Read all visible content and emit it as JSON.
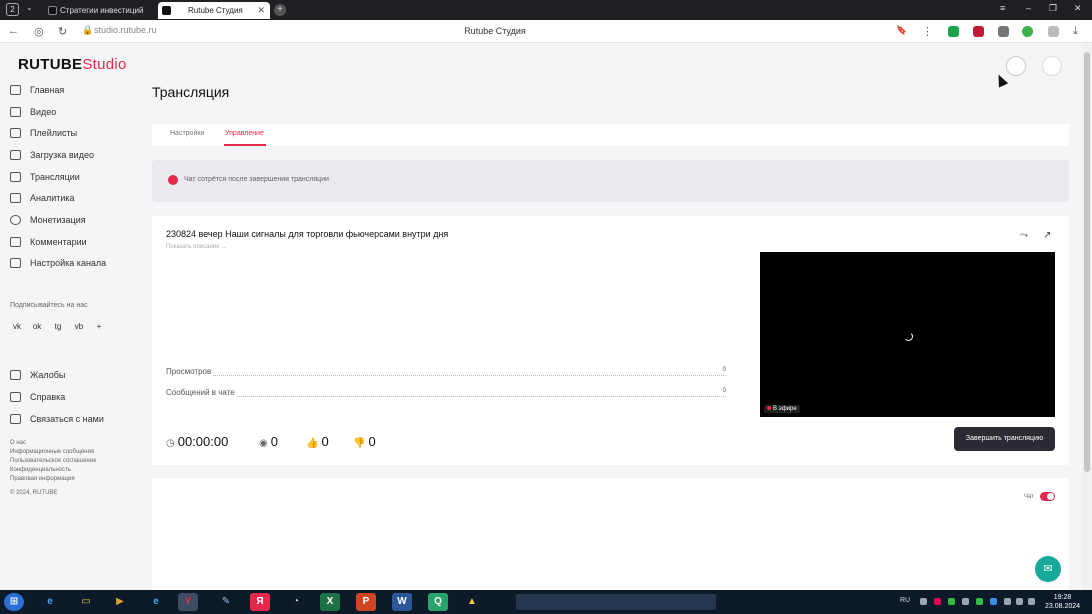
{
  "browser": {
    "tab_count": "2",
    "tabs": [
      {
        "label": "Стратегии инвестиций"
      },
      {
        "label": "Rutube Студия"
      }
    ],
    "url": "studio.rutube.ru",
    "page_title": "Rutube Студия",
    "window_controls": {
      "menu": "≡",
      "minimize": "–",
      "maximize": "❐",
      "close": "✕"
    }
  },
  "logo": {
    "brand": "RUTUBE",
    "product": "Studio"
  },
  "sidebar": {
    "items": [
      {
        "label": "Главная",
        "icon": "home-icon"
      },
      {
        "label": "Видео",
        "icon": "video-icon"
      },
      {
        "label": "Плейлисты",
        "icon": "playlist-icon"
      },
      {
        "label": "Загрузка видео",
        "icon": "upload-icon"
      },
      {
        "label": "Трансляции",
        "icon": "broadcast-icon"
      },
      {
        "label": "Аналитика",
        "icon": "analytics-icon"
      },
      {
        "label": "Монетизация",
        "icon": "money-icon"
      },
      {
        "label": "Комментарии",
        "icon": "comments-icon"
      },
      {
        "label": "Настройка канала",
        "icon": "settings-icon"
      }
    ],
    "subscribe_label": "Подписывайтесь на нас",
    "social": [
      "vk",
      "ok",
      "tg",
      "vb",
      "+"
    ],
    "support": [
      {
        "label": "Жалобы",
        "icon": "flag-icon"
      },
      {
        "label": "Справка",
        "icon": "help-icon"
      },
      {
        "label": "Связаться с нами",
        "icon": "phone-icon"
      }
    ],
    "footer_links": [
      "О нас",
      "Информационные сообщения",
      "Пользовательское соглашение",
      "Конфиденциальность",
      "Правовая информация"
    ],
    "copyright": "© 2024, RUTUBE"
  },
  "main": {
    "title": "Трансляция",
    "tabs": [
      {
        "label": "Настройки"
      },
      {
        "label": "Управление"
      }
    ],
    "notice": "Чат сотрётся после завершения трансляции",
    "stream": {
      "title": "230824 вечер Наши сигналы для торговли фьючерсами внутри дня",
      "show_description": "Показать описание",
      "stats": [
        {
          "label": "Просмотров",
          "value": "0"
        },
        {
          "label": "Сообщений в чате",
          "value": "0"
        }
      ],
      "live_badge": "В эфире",
      "duration": "00:00:00",
      "viewers": "0",
      "likes": "0",
      "dislikes": "0",
      "end_button": "Завершить трансляцию"
    },
    "chat": {
      "label": "Чат",
      "enabled": true
    }
  },
  "taskbar": {
    "lang": "RU",
    "time": "19:28",
    "date": "23.08.2024"
  },
  "colors": {
    "accent": "#e6294a",
    "dark_button": "#2b2c33",
    "fab": "#18a89a"
  }
}
